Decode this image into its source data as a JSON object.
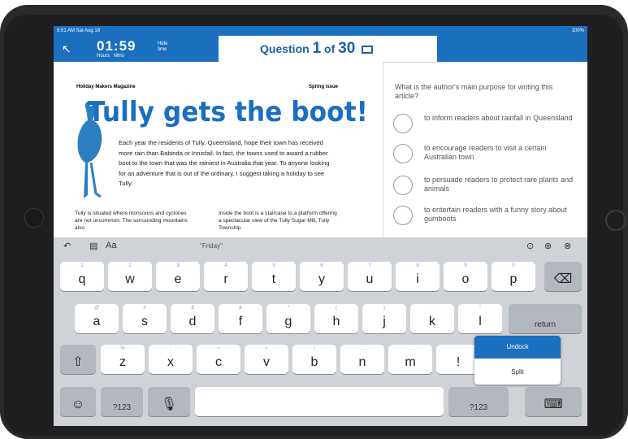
{
  "status_bar": {
    "time": "8:51 AM  Sat Aug 18",
    "battery": "100%"
  },
  "header": {
    "timer_value": "01:59",
    "timer_unit_hours": "Hours",
    "timer_unit_mins": "Mins",
    "hide_label_1": "Hide",
    "hide_label_2": "time",
    "question_prefix": "Question ",
    "question_number": "1",
    "question_of": " of ",
    "question_total": "30"
  },
  "article": {
    "magazine": "Holiday Makers Magazine",
    "issue": "Spring issue",
    "headline": "Tully gets the boot!",
    "paragraph": "Each year the residents of Tully, Queensland, hope their town has received more rain than Babinda or Innisfail. In fact, the towns used to award a rubber boot to the town that was the rainiest in Australia that year. To anyone looking for an adventure that is out of the ordinary, I suggest taking a holiday to see Tully.",
    "column1": "Tully is situated where monsoons and cyclones are not uncommon. The surrounding mountains also",
    "column2": "Inside the boot is a staircase to a platform offering a spectacular view of the Tully Sugar Mill, Tully Township"
  },
  "question_panel": {
    "prompt": "What is the author's main purpose for writing this article?",
    "options": [
      "to inform readers about rainfall in Queensland",
      "to encourage readers to visit a certain Australian town",
      "to persuade readers to protect rare plants and animals",
      "to entertain readers with a funny story about gumboots"
    ]
  },
  "keyboard": {
    "toolbar": {
      "format_label": "Aa",
      "suggestion": "\"Friday\""
    },
    "row1": [
      {
        "k": "q",
        "s": "1"
      },
      {
        "k": "w",
        "s": "2"
      },
      {
        "k": "e",
        "s": "3"
      },
      {
        "k": "r",
        "s": "4"
      },
      {
        "k": "t",
        "s": "5"
      },
      {
        "k": "y",
        "s": "6"
      },
      {
        "k": "u",
        "s": "7"
      },
      {
        "k": "i",
        "s": "8"
      },
      {
        "k": "o",
        "s": "9"
      },
      {
        "k": "p",
        "s": "0"
      }
    ],
    "row2": [
      {
        "k": "a",
        "s": "@"
      },
      {
        "k": "s",
        "s": "#"
      },
      {
        "k": "d",
        "s": "$"
      },
      {
        "k": "f",
        "s": "&"
      },
      {
        "k": "g",
        "s": "*"
      },
      {
        "k": "h",
        "s": "("
      },
      {
        "k": "j",
        "s": ")"
      },
      {
        "k": "k",
        "s": "'"
      },
      {
        "k": "l",
        "s": "\""
      }
    ],
    "row3": [
      {
        "k": "z",
        "s": "%"
      },
      {
        "k": "x",
        "s": "-"
      },
      {
        "k": "c",
        "s": "+"
      },
      {
        "k": "v",
        "s": "="
      },
      {
        "k": "b",
        "s": "/"
      },
      {
        "k": "n",
        "s": ";"
      },
      {
        "k": "m",
        "s": ":"
      },
      {
        "k": "!",
        "s": ""
      }
    ],
    "return_label": "return",
    "numbers_label": "?123",
    "numbers_label_right": "?123",
    "popup": {
      "undock": "Undock",
      "split": "Split"
    }
  },
  "colors": {
    "accent": "#1a6fbf"
  }
}
